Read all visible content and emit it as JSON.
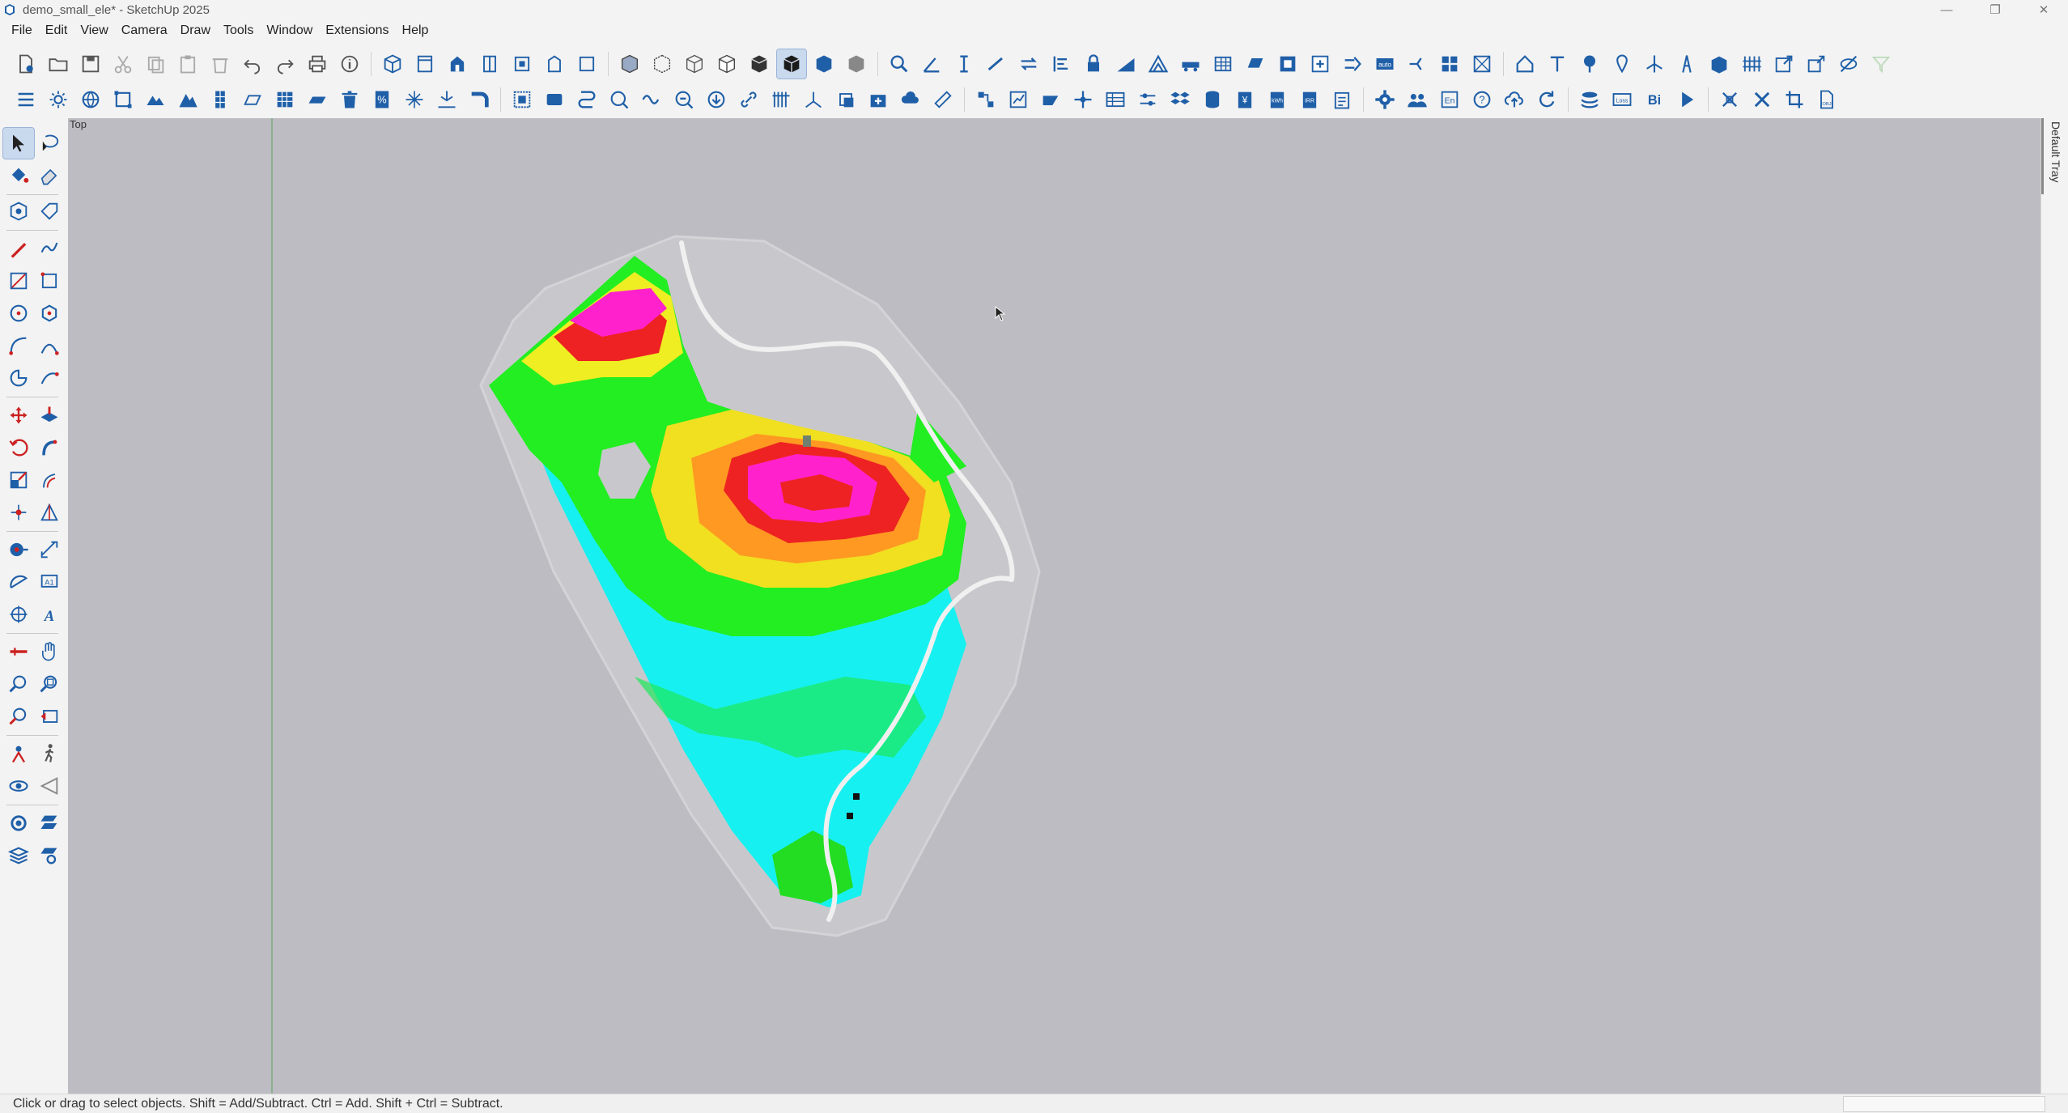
{
  "window": {
    "title": "demo_small_ele* - SketchUp 2025",
    "controls": [
      "minimize-icon",
      "restore-icon",
      "close-icon"
    ]
  },
  "menubar": {
    "items": [
      "File",
      "Edit",
      "View",
      "Camera",
      "Draw",
      "Tools",
      "Window",
      "Extensions",
      "Help"
    ]
  },
  "toolbar_top": {
    "active_tool": "shaded-with-textures-style"
  },
  "viewport": {
    "scene_label": "Top",
    "background": "#bcbcc2",
    "green_axis_color": "#7aa67a"
  },
  "tray": {
    "label": "Default Tray"
  },
  "status": {
    "text": "Click or drag to select objects. Shift = Add/Subtract. Ctrl = Add. Shift + Ctrl = Subtract."
  },
  "colors": {
    "accent_icon": "#1f5fa8",
    "terrain_cyan": "#17f0f0",
    "terrain_green": "#22ee22",
    "terrain_yellow": "#eeee22",
    "terrain_orange": "#ff9922",
    "terrain_red": "#ee2222",
    "terrain_magenta": "#ff22cc",
    "road": "#f0f0f0"
  }
}
